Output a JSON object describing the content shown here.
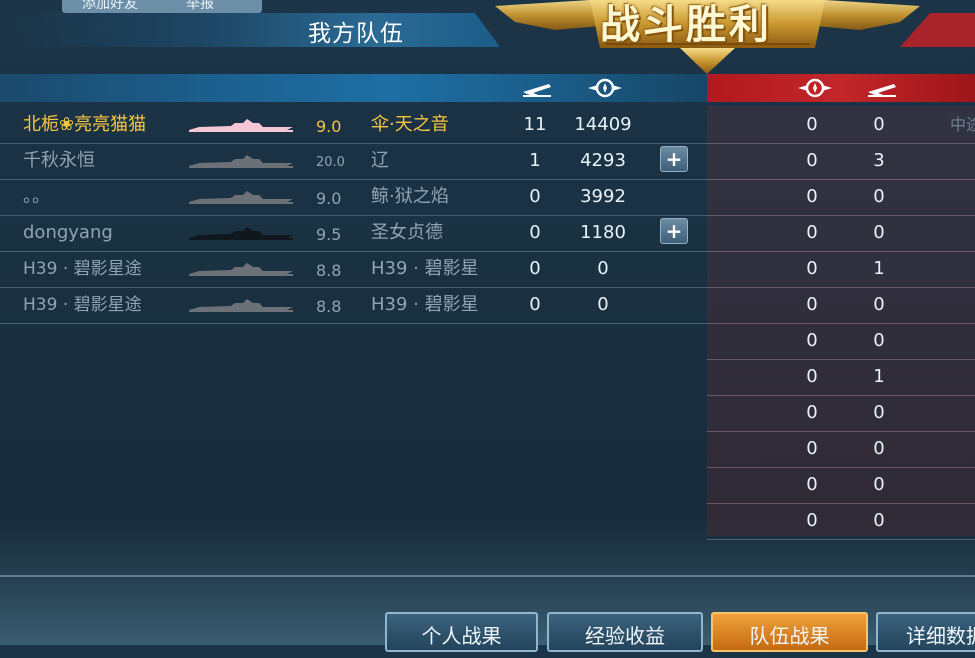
{
  "top_tabs": {
    "add_friend": "添加好友",
    "report": "举报"
  },
  "team": {
    "title": "我方队伍"
  },
  "banner": {
    "victory": "战斗胜利"
  },
  "colors": {
    "self_gold": "#f4c542",
    "normal_text": "#8fa4b4",
    "enemy_red": "#b1191f",
    "accent_blue": "#1e6fa4"
  },
  "icons": [
    "plane-icon",
    "medal-icon"
  ],
  "players": [
    {
      "name": "北栀❀亮亮猫猫",
      "score": "9.0",
      "ship": "伞·天之音",
      "kills": "11",
      "damage": "14409",
      "add_friend": false,
      "highlight": true
    },
    {
      "name": "千秋永恒",
      "score": "20.0",
      "ship": "辽",
      "kills": "1",
      "damage": "4293",
      "add_friend": true,
      "highlight": false
    },
    {
      "name": "。。",
      "score": "9.0",
      "ship": "鲸·狱之焰",
      "kills": "0",
      "damage": "3992",
      "add_friend": false,
      "highlight": false
    },
    {
      "name": "dongyang",
      "score": "9.5",
      "ship": "圣女贞德",
      "kills": "0",
      "damage": "1180",
      "add_friend": true,
      "highlight": false
    },
    {
      "name": "H39 · 碧影星途",
      "score": "8.8",
      "ship": "H39 · 碧影星",
      "kills": "0",
      "damage": "0",
      "add_friend": false,
      "highlight": false
    },
    {
      "name": "H39 · 碧影星途",
      "score": "8.8",
      "ship": "H39 · 碧影星",
      "kills": "0",
      "damage": "0",
      "add_friend": false,
      "highlight": false
    }
  ],
  "enemy_rows": [
    {
      "medal": "0",
      "plane": "0",
      "extra": "中途"
    },
    {
      "medal": "0",
      "plane": "3",
      "extra": ""
    },
    {
      "medal": "0",
      "plane": "0",
      "extra": ""
    },
    {
      "medal": "0",
      "plane": "0",
      "extra": ""
    },
    {
      "medal": "0",
      "plane": "1",
      "extra": ""
    },
    {
      "medal": "0",
      "plane": "0",
      "extra": ""
    },
    {
      "medal": "0",
      "plane": "0",
      "extra": ""
    },
    {
      "medal": "0",
      "plane": "1",
      "extra": ""
    },
    {
      "medal": "0",
      "plane": "0",
      "extra": ""
    },
    {
      "medal": "0",
      "plane": "0",
      "extra": ""
    },
    {
      "medal": "0",
      "plane": "0",
      "extra": ""
    },
    {
      "medal": "0",
      "plane": "0",
      "extra": ""
    }
  ],
  "bottom_tabs": [
    {
      "label": "个人战果",
      "active": false
    },
    {
      "label": "经验收益",
      "active": false
    },
    {
      "label": "队伍战果",
      "active": true
    },
    {
      "label": "详细数据",
      "active": false
    }
  ]
}
